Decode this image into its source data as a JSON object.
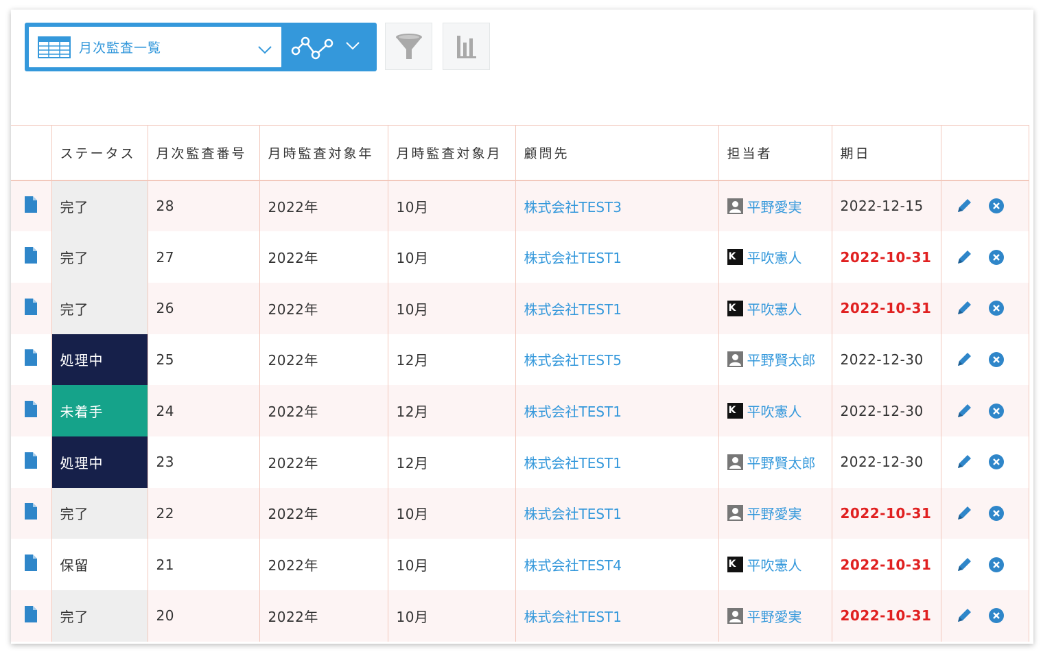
{
  "toolbar": {
    "view_name": "月次監査一覧",
    "icons": [
      "table-icon",
      "chevron-down-icon",
      "graph-icon",
      "chevron-down-icon",
      "filter-icon",
      "bar-chart-icon"
    ]
  },
  "table": {
    "headers": [
      "",
      "ステータス",
      "月次監査番号",
      "月時監査対象年",
      "月時監査対象月",
      "顧問先",
      "担当者",
      "期日",
      ""
    ],
    "rows": [
      {
        "status": "完了",
        "status_type": "done",
        "number": "28",
        "year": "2022年",
        "month": "10月",
        "client": "株式会社TEST3",
        "assignee": "平野愛実",
        "avatar": "person",
        "due": "2022-12-15",
        "overdue": false
      },
      {
        "status": "完了",
        "status_type": "done",
        "number": "27",
        "year": "2022年",
        "month": "10月",
        "client": "株式会社TEST1",
        "assignee": "平吹憲人",
        "avatar": "k",
        "due": "2022-10-31",
        "overdue": true
      },
      {
        "status": "完了",
        "status_type": "done",
        "number": "26",
        "year": "2022年",
        "month": "10月",
        "client": "株式会社TEST1",
        "assignee": "平吹憲人",
        "avatar": "k",
        "due": "2022-10-31",
        "overdue": true
      },
      {
        "status": "処理中",
        "status_type": "progress",
        "number": "25",
        "year": "2022年",
        "month": "12月",
        "client": "株式会社TEST5",
        "assignee": "平野賢太郎",
        "avatar": "person",
        "due": "2022-12-30",
        "overdue": false
      },
      {
        "status": "未着手",
        "status_type": "new",
        "number": "24",
        "year": "2022年",
        "month": "12月",
        "client": "株式会社TEST1",
        "assignee": "平吹憲人",
        "avatar": "k",
        "due": "2022-12-30",
        "overdue": false
      },
      {
        "status": "処理中",
        "status_type": "progress",
        "number": "23",
        "year": "2022年",
        "month": "12月",
        "client": "株式会社TEST1",
        "assignee": "平野賢太郎",
        "avatar": "person",
        "due": "2022-12-30",
        "overdue": false
      },
      {
        "status": "完了",
        "status_type": "done",
        "number": "22",
        "year": "2022年",
        "month": "10月",
        "client": "株式会社TEST1",
        "assignee": "平野愛実",
        "avatar": "person",
        "due": "2022-10-31",
        "overdue": true
      },
      {
        "status": "保留",
        "status_type": "hold",
        "number": "21",
        "year": "2022年",
        "month": "10月",
        "client": "株式会社TEST4",
        "assignee": "平吹憲人",
        "avatar": "k",
        "due": "2022-10-31",
        "overdue": true
      },
      {
        "status": "完了",
        "status_type": "done",
        "number": "20",
        "year": "2022年",
        "month": "10月",
        "client": "株式会社TEST1",
        "assignee": "平野愛実",
        "avatar": "person",
        "due": "2022-10-31",
        "overdue": true
      }
    ]
  },
  "colors": {
    "accent": "#3498db",
    "overdue": "#e02020",
    "status_done_bg": "#eeeeee",
    "status_progress_bg": "#16204a",
    "status_new_bg": "#15a38a",
    "row_alt_bg": "#fdf4f4",
    "grid_line": "#f2c8bc"
  }
}
